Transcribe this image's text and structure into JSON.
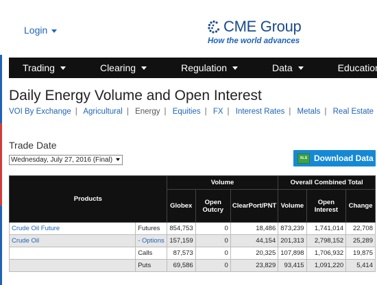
{
  "header": {
    "login_label": "Login",
    "logo_name": "CME Group",
    "logo_tagline": "How the world advances"
  },
  "nav": {
    "items": [
      "Trading",
      "Clearing",
      "Regulation",
      "Data",
      "Education"
    ]
  },
  "page_title": "Daily Energy Volume and Open Interest",
  "subnav": {
    "items": [
      "VOI By Exchange",
      "Agricultural",
      "Energy",
      "Equities",
      "FX",
      "Interest Rates",
      "Metals",
      "Real Estate"
    ],
    "current": "Energy",
    "overflow_glyph": "V"
  },
  "trade_date": {
    "label": "Trade Date",
    "selected": "Wednesday, July 27, 2016 (Final)"
  },
  "download": {
    "label": "Download Data",
    "icon_text": "XLS"
  },
  "table": {
    "group_headers": {
      "products": "Products",
      "volume": "Volume",
      "oi": "Overall Combined Total"
    },
    "columns": [
      "Globex",
      "Open Outcry",
      "ClearPort/PNT",
      "Volume",
      "Open Interest",
      "Change"
    ],
    "rows": [
      {
        "product": "Crude Oil Future",
        "type": "Futures",
        "globex": "854,753",
        "outcry": "0",
        "clearport": "18,486",
        "volume": "873,239",
        "oi": "1,741,014",
        "change": "22,708"
      },
      {
        "product": "Crude Oil",
        "type": "- Options",
        "globex": "157,159",
        "outcry": "0",
        "clearport": "44,154",
        "volume": "201,313",
        "oi": "2,798,152",
        "change": "25,289"
      },
      {
        "product": "",
        "type": "Calls",
        "globex": "87,573",
        "outcry": "0",
        "clearport": "20,325",
        "volume": "107,898",
        "oi": "1,706,932",
        "change": "19,875"
      },
      {
        "product": "",
        "type": "Puts",
        "globex": "69,586",
        "outcry": "0",
        "clearport": "23,829",
        "volume": "93,415",
        "oi": "1,091,220",
        "change": "5,414"
      }
    ]
  },
  "colors": {
    "brand_blue": "#1a4b8c",
    "link_blue": "#1f63b7",
    "nav_bg": "#111111",
    "download_bg": "#1689d6",
    "strip": [
      "#1f63b7",
      "#d63a3a",
      "#2e9c44",
      "#e89a23"
    ]
  }
}
